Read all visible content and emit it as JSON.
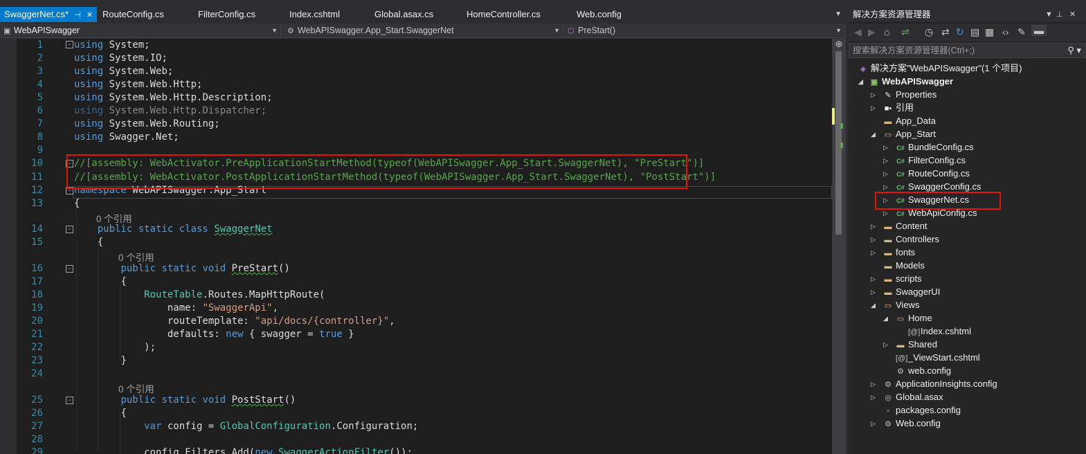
{
  "tabs": [
    {
      "label": "SwaggerNet.cs*",
      "active": true
    },
    {
      "label": "RouteConfig.cs"
    },
    {
      "label": "FilterConfig.cs"
    },
    {
      "label": "Index.cshtml"
    },
    {
      "label": "Global.asax.cs"
    },
    {
      "label": "HomeController.cs"
    },
    {
      "label": "Web.config"
    }
  ],
  "navbar": {
    "project": "WebAPISwagger",
    "type": "WebAPISwagger.App_Start.SwaggerNet",
    "member": "PreStart()"
  },
  "code": {
    "line_numbers": [
      "1",
      "2",
      "3",
      "4",
      "5",
      "6",
      "7",
      "8",
      "9",
      "10",
      "11",
      "12",
      "13",
      "14",
      "15",
      "16",
      "17",
      "18",
      "19",
      "20",
      "21",
      "22",
      "23",
      "24",
      "25",
      "26",
      "27",
      "28",
      "29"
    ],
    "lines": {
      "using": "using",
      "u1": " System;",
      "u2": " System.IO;",
      "u3": " System.Web;",
      "u4": " System.Web.Http;",
      "u5": " System.Web.Http.Description;",
      "u6": " System.Web.Http.Dispatcher;",
      "u7": " System.Web.Routing;",
      "u8": " Swagger.Net;",
      "l10": "//[assembly: WebActivator.PreApplicationStartMethod(typeof(WebAPISwagger.App_Start.SwaggerNet), \"PreStart\")]",
      "l11": "//[assembly: WebActivator.PostApplicationStartMethod(typeof(WebAPISwagger.App_Start.SwaggerNet), \"PostStart\")]",
      "l12_kw": "namespace",
      "l12_rest": " WebAPISwagger.App_Start",
      "open_brace": "{",
      "close_brace": "}",
      "refs0": "0 个引用",
      "l14_kw": "public static class",
      "l14_name": "SwaggerNet",
      "l16_kw": "public static void",
      "l16_name": "PreStart",
      "parens": "()",
      "l18_type": "RouteTable",
      "l18_rest": ".Routes.MapHttpRoute(",
      "l19_a": "name: ",
      "l19_s": "\"SwaggerApi\"",
      "comma": ",",
      "l20_a": "routeTemplate: ",
      "l20_s": "\"api/docs/{controller}\"",
      "l21_a": "defaults: ",
      "l21_new": "new",
      "l21_b": " { swagger = ",
      "l21_true": "true",
      "l21_c": " }",
      "l22": ");",
      "l25_name": "PostStart",
      "l27_var": "var",
      "l27_a": " config = ",
      "l27_type": "GlobalConfiguration",
      "l27_b": ".Configuration;",
      "l29_a": "config.Filters.Add(",
      "l29_new": "new",
      "l29_type": "SwaggerActionFilter",
      "l29_b": "());"
    }
  },
  "explorer": {
    "title": "解决方案资源管理器",
    "search_placeholder": "搜索解决方案资源管理器(Ctrl+;)",
    "solution": "解决方案\"WebAPISwagger\"(1 个项目)",
    "project": "WebAPISwagger",
    "items": {
      "properties": "Properties",
      "references": "引用",
      "app_data": "App_Data",
      "app_start": "App_Start",
      "bundle": "BundleConfig.cs",
      "filter": "FilterConfig.cs",
      "route": "RouteConfig.cs",
      "swaggerconfig": "SwaggerConfig.cs",
      "swaggernet": "SwaggerNet.cs",
      "webapiconfig": "WebApiConfig.cs",
      "content": "Content",
      "controllers": "Controllers",
      "fonts": "fonts",
      "models": "Models",
      "scripts": "scripts",
      "swaggerui": "SwaggerUI",
      "views": "Views",
      "home": "Home",
      "index": "Index.cshtml",
      "shared": "Shared",
      "viewstart": "_ViewStart.cshtml",
      "webconfig_views": "web.config",
      "appinsights": "ApplicationInsights.config",
      "global": "Global.asax",
      "packages": "packages.config",
      "webconfig": "Web.config"
    }
  }
}
